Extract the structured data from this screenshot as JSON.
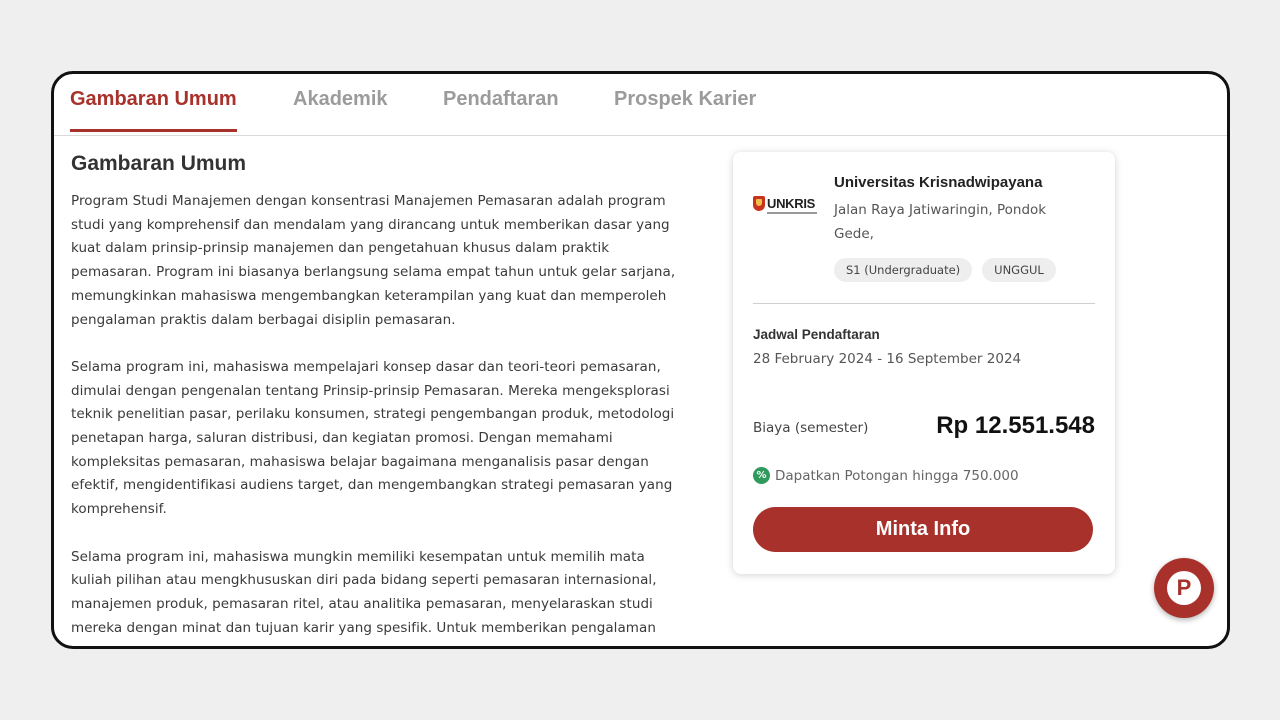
{
  "tabs": [
    {
      "label": "Gambaran Umum",
      "active": true
    },
    {
      "label": "Akademik",
      "active": false
    },
    {
      "label": "Pendaftaran",
      "active": false
    },
    {
      "label": "Prospek Karier",
      "active": false
    }
  ],
  "main": {
    "title": "Gambaran Umum",
    "paragraphs": [
      "Program Studi Manajemen dengan konsentrasi Manajemen Pemasaran adalah program studi yang komprehensif dan mendalam yang dirancang untuk memberikan dasar yang kuat dalam prinsip-prinsip manajemen dan pengetahuan khusus dalam praktik pemasaran. Program ini biasanya berlangsung selama empat tahun untuk gelar sarjana, memungkinkan mahasiswa mengembangkan keterampilan yang kuat dan memperoleh pengalaman praktis dalam berbagai disiplin pemasaran.",
      "Selama program ini, mahasiswa mempelajari konsep dasar dan teori-teori pemasaran, dimulai dengan pengenalan tentang Prinsip-prinsip Pemasaran. Mereka mengeksplorasi teknik penelitian pasar, perilaku konsumen, strategi pengembangan produk, metodologi penetapan harga, saluran distribusi, dan kegiatan promosi. Dengan memahami kompleksitas pemasaran, mahasiswa belajar bagaimana menganalisis pasar dengan efektif, mengidentifikasi audiens target, dan mengembangkan strategi pemasaran yang komprehensif.",
      "Selama program ini, mahasiswa mungkin memiliki kesempatan untuk memilih mata kuliah pilihan atau mengkhususkan diri pada bidang seperti pemasaran internasional, manajemen produk, pemasaran ritel, atau analitika pemasaran, menyelaraskan studi mereka dengan minat dan tujuan karir yang spesifik. Untuk memberikan pengalaman"
    ]
  },
  "card": {
    "logo_text": "UNKRIS",
    "university_name": "Universitas Krisnadwipayana",
    "address": "Jalan Raya Jatiwaringin, Pondok Gede,",
    "badges": [
      "S1 (Undergraduate)",
      "UNGGUL"
    ],
    "schedule_label": "Jadwal Pendaftaran",
    "schedule_value": "28 February 2024 - 16 September 2024",
    "fee_label": "Biaya (semester)",
    "fee_value": "Rp 12.551.548",
    "discount_icon": "%",
    "discount_text": "Dapatkan Potongan hingga 750.000",
    "cta_label": "Minta Info"
  },
  "fab": {
    "icon": "chat-p-icon",
    "glyph": "P"
  },
  "colors": {
    "accent": "#a8322b",
    "discount_green": "#2f9a5c"
  }
}
